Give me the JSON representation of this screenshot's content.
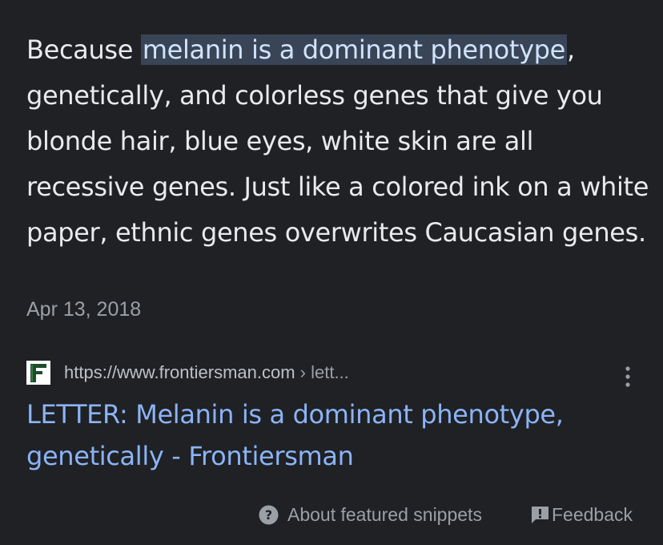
{
  "snippet": {
    "text_before": "Because ",
    "highlight": "melanin is a dominant phenotype",
    "text_after": ", genetically, and colorless genes that give you blonde hair, blue eyes, white skin are all recessive genes. Just like a colored ink on a white paper, ethnic genes overwrites Caucasian genes.",
    "date": "Apr 13, 2018"
  },
  "source": {
    "favicon_letter": "F",
    "url": "https://www.frontiersman.com",
    "breadcrumb": " › lett...",
    "title": "LETTER: Melanin is a dominant phenotype, genetically - Frontiersman"
  },
  "footer": {
    "about_label": "About featured snippets",
    "feedback_label": "Feedback"
  },
  "colors": {
    "background": "#202124",
    "text": "#e8eaed",
    "highlight_bg": "#394457",
    "link": "#8ab4f8",
    "muted": "#9aa0a6"
  },
  "icons": {
    "favicon": "frontiersman-f-icon",
    "more": "more-vert-icon",
    "about": "help-circle-icon",
    "feedback": "feedback-icon"
  }
}
